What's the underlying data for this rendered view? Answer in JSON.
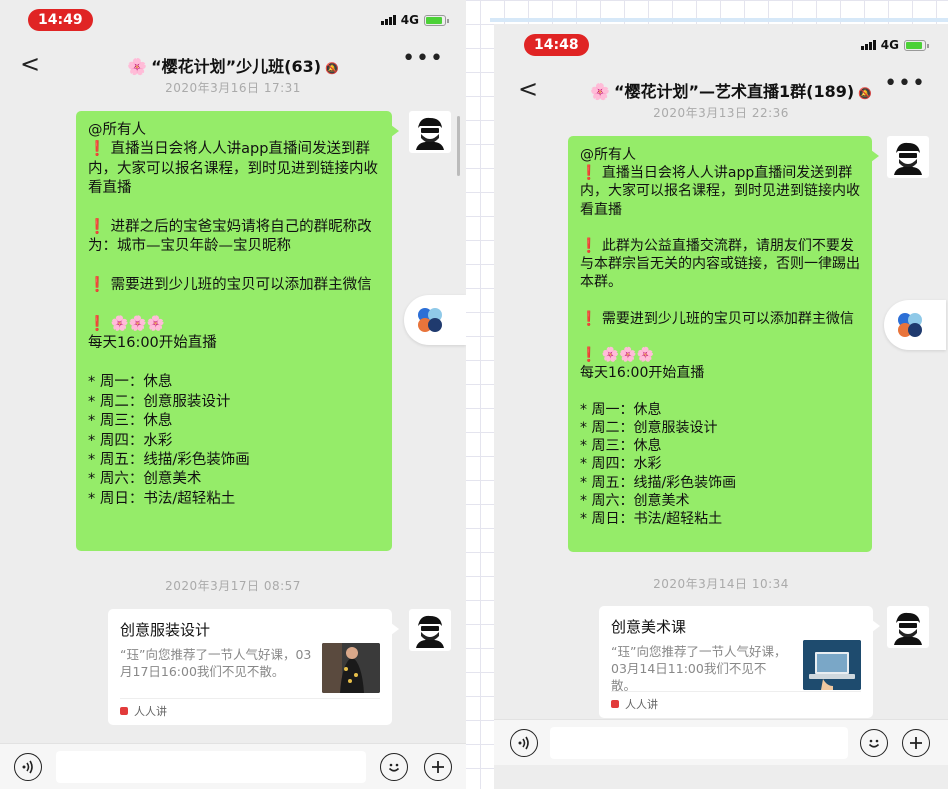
{
  "colors": {
    "bubble_green": "#95ec69",
    "time_red": "#e02424",
    "chat_bg": "#ededed"
  },
  "icons": [
    "back-icon",
    "more-icon",
    "mute-icon",
    "voice-icon",
    "emoji-icon",
    "plus-icon",
    "exclamation-icon",
    "flower-icon"
  ],
  "left": {
    "status": {
      "time": "14:49",
      "network": "4G"
    },
    "nav": {
      "back": "<",
      "flower": "🌸",
      "title": "“樱花计划”少儿班(63)",
      "mute": "🔕",
      "more": "•••"
    },
    "msg1": {
      "timestamp": "2020年3月16日 17:31",
      "text": "@所有人\n❗ 直播当日会将人人讲app直播间发送到群内，大家可以报名课程，到时见进到链接内收看直播\n\n❗ 进群之后的宝爸宝妈请将自己的群昵称改为：城市—宝贝年龄—宝贝昵称\n\n❗ 需要进到少儿班的宝贝可以添加群主微信\n\n❗ 🌸🌸🌸\n每天16:00开始直播\n\n* 周一：休息\n* 周二：创意服装设计\n* 周三：休息\n* 周四：水彩\n* 周五：线描/彩色装饰画\n* 周六：创意美术\n* 周日：书法/超轻粘土"
    },
    "msg2": {
      "timestamp": "2020年3月17日 08:57",
      "card_title": "创意服装设计",
      "card_desc": "“珏”向您推荐了一节人气好课，03月17日16:00我们不见不散。",
      "card_source": "人人讲"
    }
  },
  "right": {
    "status": {
      "time": "14:48",
      "network": "4G"
    },
    "nav": {
      "back": "<",
      "flower": "🌸",
      "title": "“樱花计划”—艺术直播1群(189)",
      "mute": "🔕",
      "more": "•••"
    },
    "msg1": {
      "timestamp": "2020年3月13日 22:36",
      "text": "@所有人\n❗ 直播当日会将人人讲app直播间发送到群内，大家可以报名课程，到时见进到链接内收看直播\n\n❗ 此群为公益直播交流群，请朋友们不要发与本群宗旨无关的内容或链接，否则一律踢出本群。\n\n❗ 需要进到少儿班的宝贝可以添加群主微信\n\n❗ 🌸🌸🌸\n每天16:00开始直播\n\n* 周一：休息\n* 周二：创意服装设计\n* 周三：休息\n* 周四：水彩\n* 周五：线描/彩色装饰画\n* 周六：创意美术\n* 周日：书法/超轻粘土"
    },
    "msg2": {
      "timestamp": "2020年3月14日 10:34",
      "card_title": "创意美术课",
      "card_desc": "“珏”向您推荐了一节人气好课，03月14日11:00我们不见不散。",
      "card_source": "人人讲"
    }
  }
}
